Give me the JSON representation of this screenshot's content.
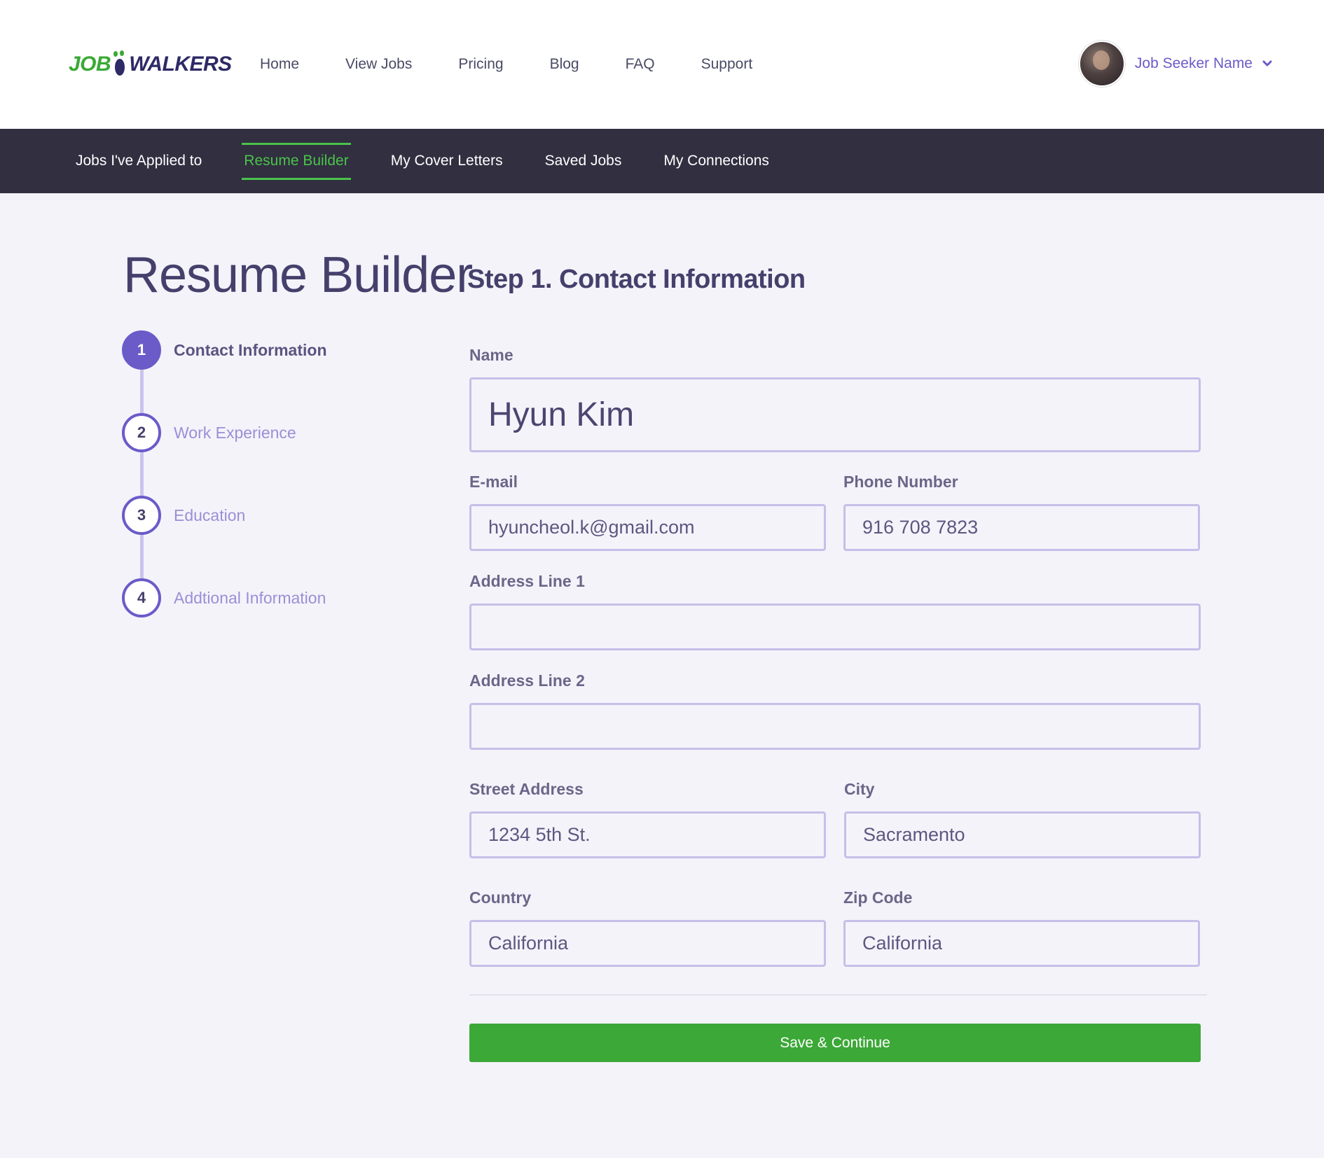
{
  "header": {
    "logo_parts": {
      "left": "JOB",
      "right": "WALKERS"
    },
    "nav": [
      {
        "label": "Home"
      },
      {
        "label": "View Jobs"
      },
      {
        "label": "Pricing"
      },
      {
        "label": "Blog"
      },
      {
        "label": "FAQ"
      },
      {
        "label": "Support"
      }
    ],
    "user_name": "Job Seeker Name"
  },
  "subnav": [
    {
      "label": "Jobs I've Applied to"
    },
    {
      "label": "Resume Builder",
      "active": true
    },
    {
      "label": "My Cover Letters"
    },
    {
      "label": "Saved Jobs"
    },
    {
      "label": "My Connections"
    }
  ],
  "page_title": "Resume Builder",
  "steps": [
    {
      "number": "1",
      "label": "Contact Information",
      "active": true
    },
    {
      "number": "2",
      "label": "Work Experience"
    },
    {
      "number": "3",
      "label": "Education"
    },
    {
      "number": "4",
      "label": "Addtional Information"
    }
  ],
  "form": {
    "heading": "Step 1. Contact Information",
    "name": {
      "label": "Name",
      "value": "Hyun Kim"
    },
    "email": {
      "label": "E-mail",
      "value": "hyuncheol.k@gmail.com"
    },
    "phone": {
      "label": "Phone Number",
      "value": "916 708 7823"
    },
    "address1": {
      "label": "Address Line 1",
      "value": ""
    },
    "address2": {
      "label": "Address Line 2",
      "value": ""
    },
    "street": {
      "label": "Street Address",
      "value": "1234 5th St."
    },
    "city": {
      "label": "City",
      "value": "Sacramento"
    },
    "country": {
      "label": "Country",
      "value": "California"
    },
    "zip": {
      "label": "Zip Code",
      "value": "California"
    },
    "save_label": "Save & Continue"
  },
  "colors": {
    "brand_green": "#3ca837",
    "brand_purple": "#6a5bc9",
    "dark_nav": "#312f40",
    "page_bg": "#f4f3fa"
  }
}
